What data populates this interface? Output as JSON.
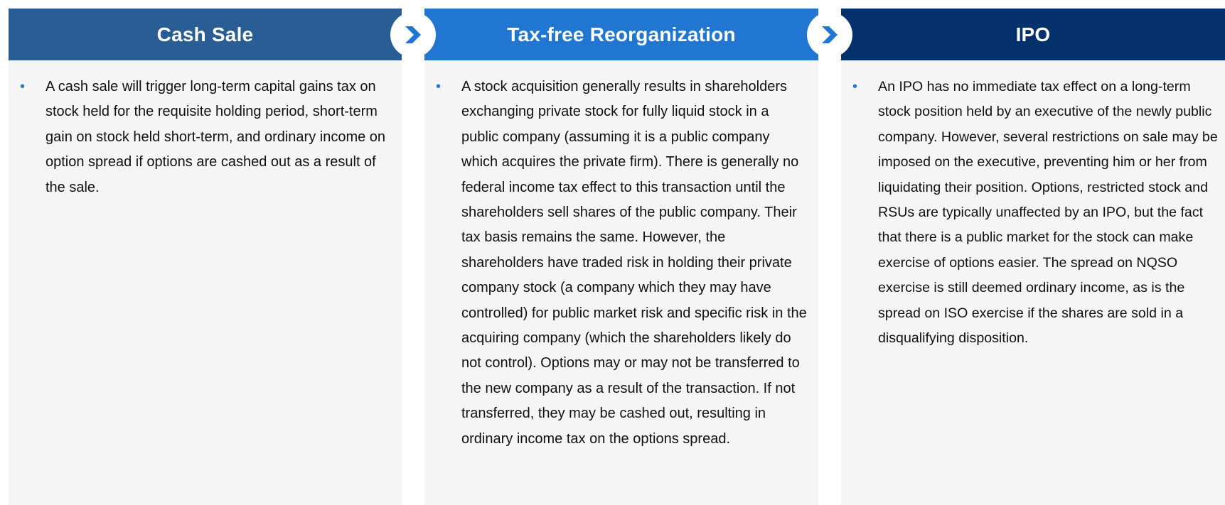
{
  "colors": {
    "cash_header": "#2a5d93",
    "tax_header": "#2176d2",
    "ipo_header": "#04306b",
    "panel_bg": "#f5f5f5",
    "bullet": "#2e75c9",
    "chevron": "#2176d2"
  },
  "columns": [
    {
      "title": "Cash Sale",
      "bullets": [
        "A cash sale will trigger long-term capital gains tax on stock held for the requisite holding period, short-term gain on stock held short-term, and ordinary income on option spread if options are cashed out as a result of the sale."
      ]
    },
    {
      "title": "Tax-free Reorganization",
      "bullets": [
        "A stock acquisition generally results in shareholders exchanging private stock for fully liquid stock in a public company (assuming it is a public company which acquires the private firm). There is generally no federal income tax effect to this transaction until the shareholders sell shares of the public company. Their tax basis remains the same. However, the shareholders have traded risk in holding their private company stock (a company which they may have controlled) for public market risk and specific risk in the acquiring company (which the shareholders likely do not control). Options may or may not be transferred to the new company as a result of the transaction. If not transferred, they may be cashed out, resulting in ordinary income tax on the options spread."
      ]
    },
    {
      "title": "IPO",
      "bullets": [
        "An IPO has no immediate tax effect on a long-term stock position held by an executive of the newly public company. However, several restrictions on sale may be imposed on the executive, preventing him or her from liquidating their position. Options, restricted stock and RSUs are typically unaffected by an IPO, but the fact that there is a public market for the stock can make exercise of options easier. The spread on NQSO exercise is still deemed ordinary income, as is the spread on ISO exercise if the shares are sold in a disqualifying disposition."
      ]
    }
  ],
  "bullet_char": "•",
  "arrows": [
    {
      "icon": "chevron-right-icon"
    },
    {
      "icon": "chevron-right-icon"
    }
  ]
}
